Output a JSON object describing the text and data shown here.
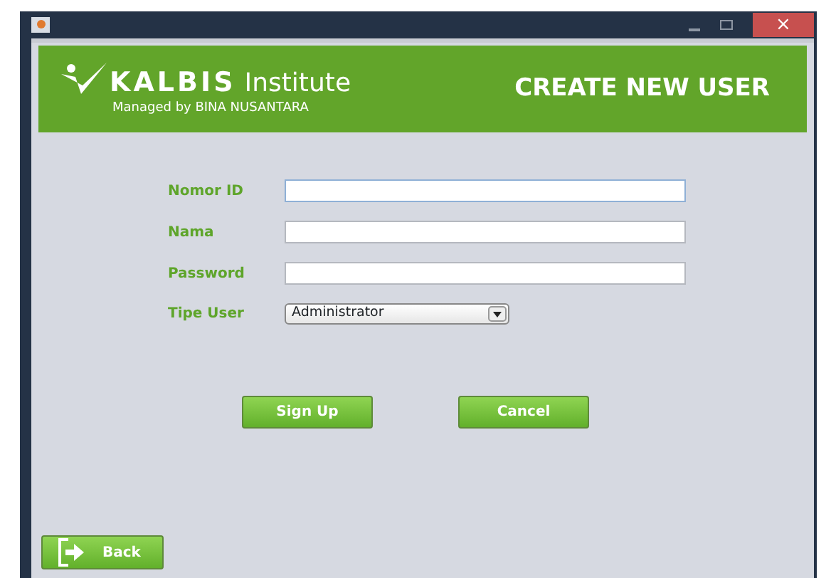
{
  "header": {
    "brand": "KALBIS",
    "brand_suffix": "Institute",
    "tagline": "Managed by BINA NUSANTARA",
    "title": "CREATE NEW USER"
  },
  "window": {
    "close": "×"
  },
  "fields": [
    {
      "label": "Nomor ID",
      "kind": "text",
      "focused": true
    },
    {
      "label": "Nama",
      "kind": "text",
      "focused": false
    },
    {
      "label": "Password",
      "kind": "password",
      "focused": false
    },
    {
      "label": "Tipe User",
      "kind": "select",
      "value": "Administrator",
      "focused": false
    }
  ],
  "buttons": [
    {
      "label": "Sign Up"
    },
    {
      "label": "Cancel"
    }
  ],
  "back_button": {
    "label": "Back"
  }
}
